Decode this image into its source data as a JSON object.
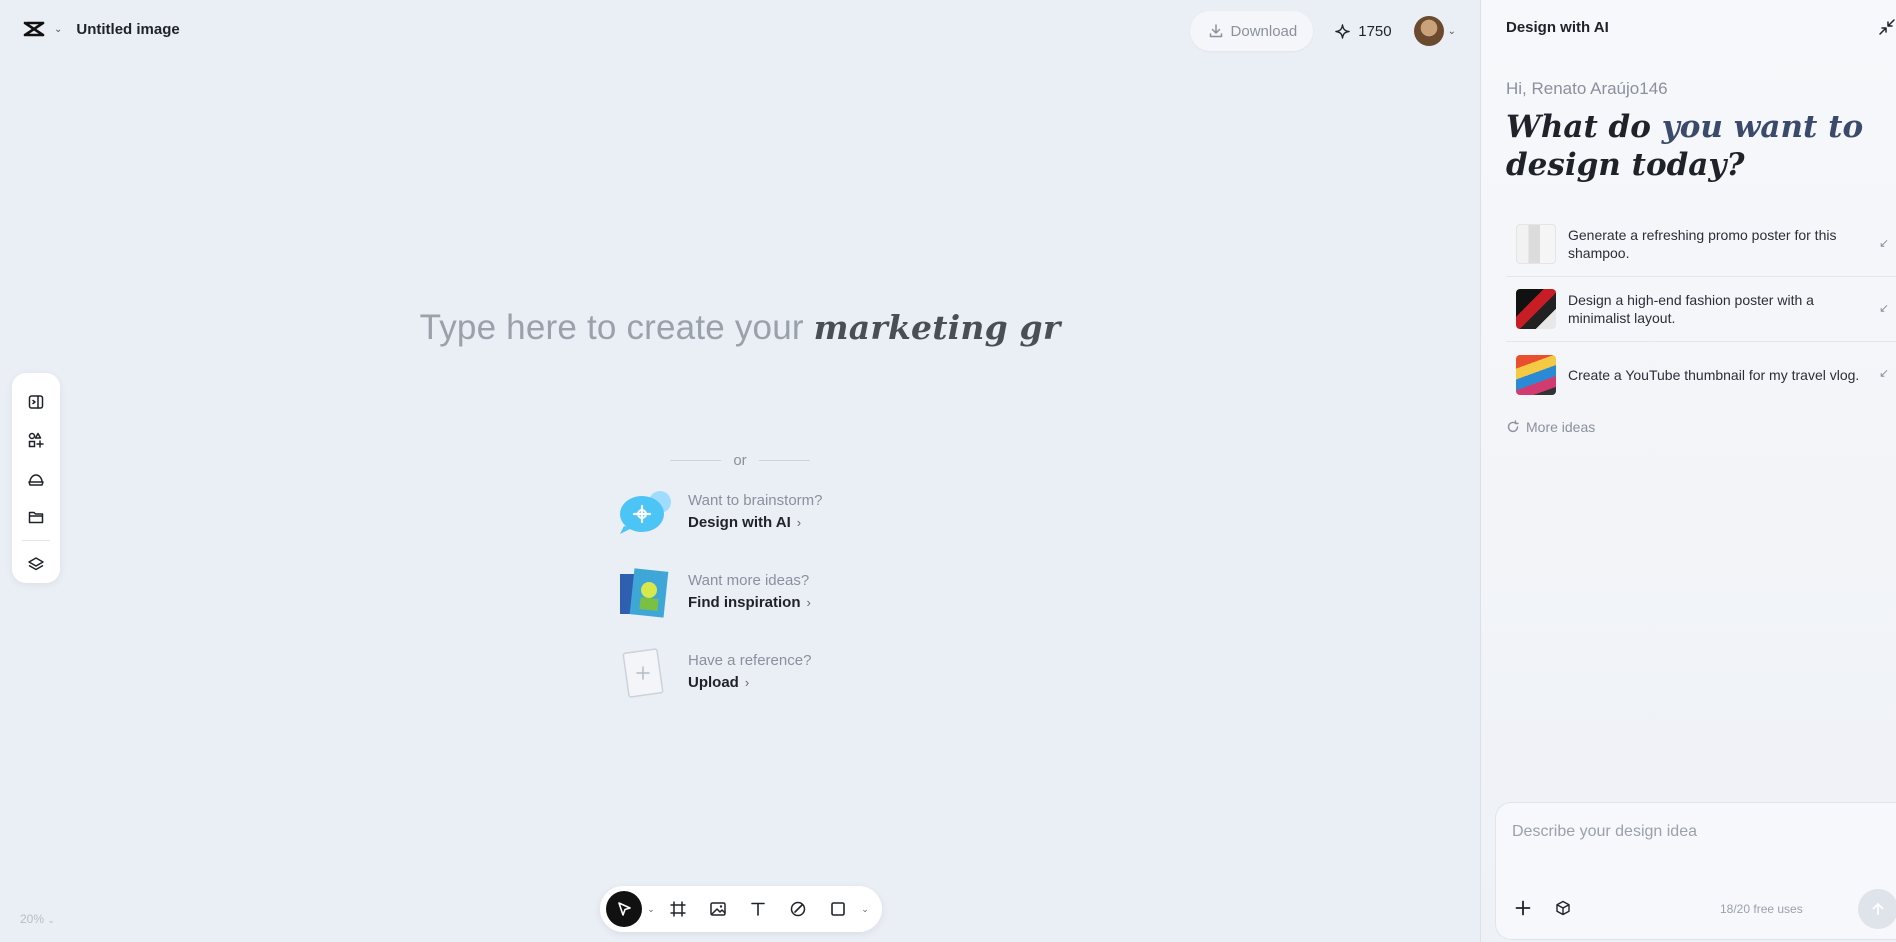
{
  "header": {
    "doc_title": "Untitled image",
    "download_label": "Download",
    "credits": "1750"
  },
  "canvas": {
    "prompt_plain": "Type here to create your ",
    "prompt_em": "marketing gr",
    "or_label": "or",
    "options": [
      {
        "question": "Want to brainstorm?",
        "action": "Design with AI"
      },
      {
        "question": "Want more ideas?",
        "action": "Find inspiration"
      },
      {
        "question": "Have a reference?",
        "action": "Upload"
      }
    ],
    "zoom": "20%"
  },
  "left_toolbar": {
    "icons": [
      "panel-icon",
      "elements-icon",
      "cloud-icon",
      "folder-icon",
      "layers-icon"
    ]
  },
  "bottom_toolbar": {
    "icons": [
      "select-pointer-icon",
      "frame-icon",
      "image-icon",
      "text-icon",
      "draw-icon",
      "shape-icon"
    ]
  },
  "panel": {
    "title": "Design with AI",
    "greeting": "Hi, Renato Araújo146",
    "headline_1": "What do ",
    "headline_2": "you want to",
    "headline_3": "design today?",
    "ideas": [
      {
        "text": "Generate a refreshing promo poster for this shampoo."
      },
      {
        "text": "Design a high-end fashion poster with a minimalist layout."
      },
      {
        "text": "Create a YouTube thumbnail for my travel vlog."
      }
    ],
    "more_ideas": "More ideas",
    "composer_placeholder": "Describe your design idea",
    "free_uses": "18/20 free uses"
  }
}
